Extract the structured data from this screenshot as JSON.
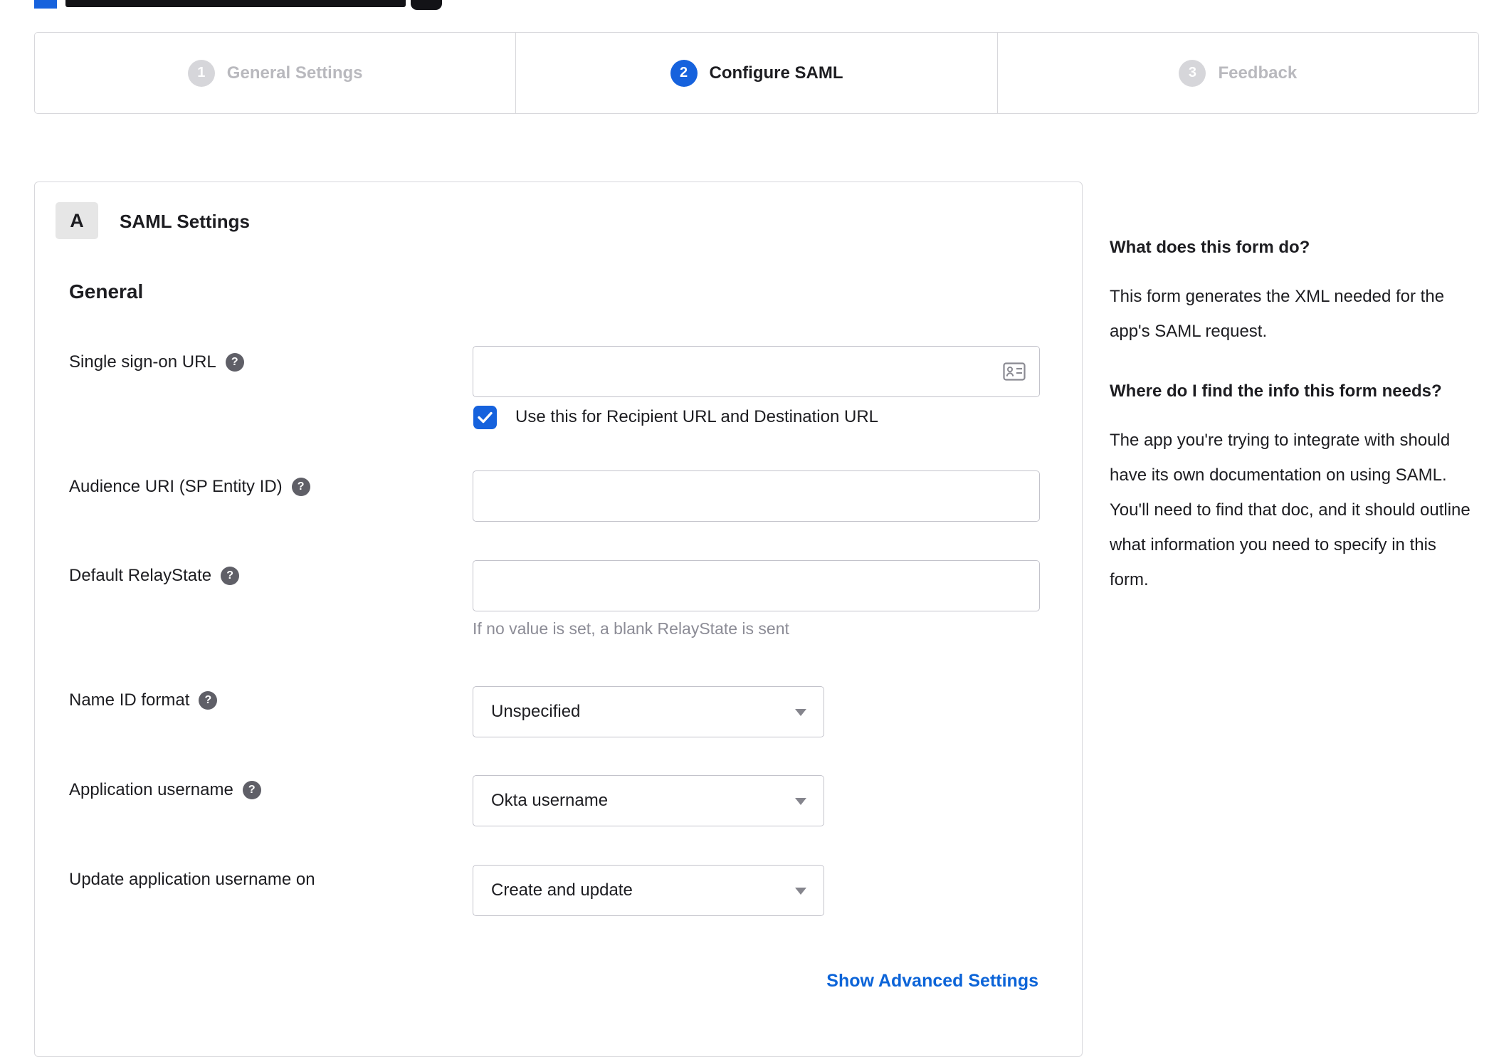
{
  "colors": {
    "accent": "#1662dd",
    "link": "#0c64d8",
    "inactive_step": "#d6d6da",
    "hint_text": "#8c8c96"
  },
  "stepper": {
    "steps": [
      {
        "number": "1",
        "label": "General Settings",
        "state": "inactive"
      },
      {
        "number": "2",
        "label": "Configure SAML",
        "state": "active"
      },
      {
        "number": "3",
        "label": "Feedback",
        "state": "inactive"
      }
    ]
  },
  "panel": {
    "badge": "A",
    "title": "SAML Settings",
    "section": "General",
    "fields": {
      "sso": {
        "label": "Single sign-on URL",
        "value": "",
        "checkbox_label": "Use this for Recipient URL and Destination URL",
        "checkbox_checked": true
      },
      "audience": {
        "label": "Audience URI (SP Entity ID)",
        "value": ""
      },
      "relay": {
        "label": "Default RelayState",
        "value": "",
        "hint": "If no value is set, a blank RelayState is sent"
      },
      "name_id": {
        "label": "Name ID format",
        "value": "Unspecified"
      },
      "app_username": {
        "label": "Application username",
        "value": "Okta username"
      },
      "update_on": {
        "label": "Update application username on",
        "value": "Create and update"
      }
    },
    "advanced_link": "Show Advanced Settings"
  },
  "help_panel": {
    "heading_1": "What does this form do?",
    "body_1": "This form generates the XML needed for the app's SAML request.",
    "heading_2": "Where do I find the info this form needs?",
    "body_2": "The app you're trying to integrate with should have its own documentation on using SAML. You'll need to find that doc, and it should outline what information you need to specify in this form."
  },
  "icons": {
    "help_glyph": "?",
    "help": "question-mark-circle",
    "sso_field": "id-card",
    "select": "caret-down",
    "checkbox": "checkmark"
  }
}
